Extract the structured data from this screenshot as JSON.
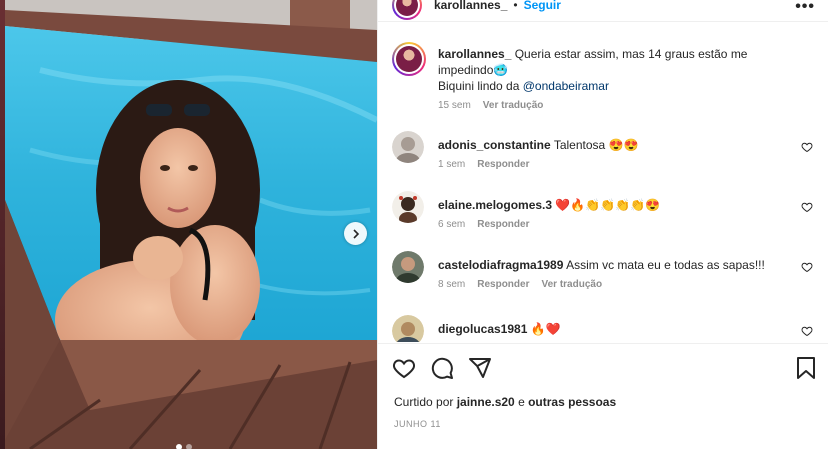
{
  "post": {
    "author": "karollannes_",
    "separator": "•",
    "follow_label": "Seguir",
    "more_label": "•••",
    "next_label": "›"
  },
  "caption": {
    "username": "karollannes_",
    "text": "Queria estar assim, mas 14 graus estão me impedindo🥶",
    "credit_prefix": "Biquini lindo da ",
    "mention": "@ondabeiramar",
    "time": "15 sem",
    "translate": "Ver tradução"
  },
  "comments": [
    {
      "username": "adonis_constantine",
      "text": "Talentosa 😍😍",
      "time": "1 sem",
      "reply": "Responder",
      "translate": ""
    },
    {
      "username": "elaine.melogomes.3",
      "text": "❤️🔥👏👏👏👏😍",
      "time": "6 sem",
      "reply": "Responder",
      "translate": ""
    },
    {
      "username": "castelodiafragma1989",
      "text": "Assim vc mata eu e todas as sapas!!!",
      "time": "8 sem",
      "reply": "Responder",
      "translate": "Ver tradução"
    },
    {
      "username": "diegolucas1981",
      "text": "🔥❤️",
      "time": "",
      "reply": "",
      "translate": ""
    }
  ],
  "likes": {
    "prefix": "Curtido por ",
    "user": "jainne.s20",
    "middle": " e ",
    "others": "outras pessoas"
  },
  "date": "JUNHO 11",
  "icons": {
    "like": "heart-icon",
    "comment": "comment-icon",
    "share": "share-icon",
    "save": "bookmark-icon",
    "next": "chevron-right-icon"
  },
  "colors": {
    "follow": "#0095f6",
    "meta": "#8e8e8e",
    "pool": "#3ab8e0",
    "deck": "#6b4136"
  }
}
